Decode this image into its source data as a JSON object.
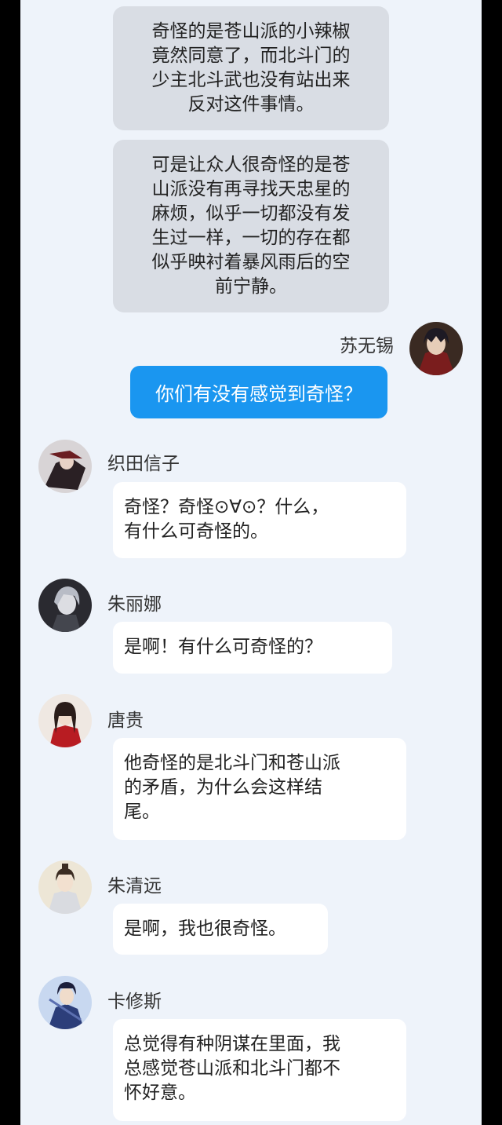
{
  "narration": [
    "奇怪的是苍山派的小辣椒\n竟然同意了，而北斗门的\n少主北斗武也没有站出来\n反对这件事情。",
    "可是让众人很奇怪的是苍\n山派没有再寻找天忠星的\n麻烦，似乎一切都没有发\n生过一样，一切的存在都\n似乎映衬着暴风雨后的空\n前宁静。"
  ],
  "self": {
    "name": "苏无锡",
    "text": "你们有没有感觉到奇怪？"
  },
  "messages": [
    {
      "name": "织田信子",
      "text": "奇怪？奇怪⊙∀⊙？什么，\n有什么可奇怪的。"
    },
    {
      "name": "朱丽娜",
      "text": "是啊！有什么可奇怪的？"
    },
    {
      "name": "唐贵",
      "text": "他奇怪的是北斗门和苍山派\n的矛盾，为什么会这样结\n尾。"
    },
    {
      "name": "朱清远",
      "text": "是啊，我也很奇怪。"
    },
    {
      "name": "卡修斯",
      "text": "总觉得有种阴谋在里面，我\n总感觉苍山派和北斗门都不\n怀好意。"
    }
  ],
  "colors": {
    "background": "#eef3fa",
    "self_bubble": "#1a96f0",
    "narration_bubble": "#d9dde4",
    "other_bubble": "#ffffff"
  }
}
